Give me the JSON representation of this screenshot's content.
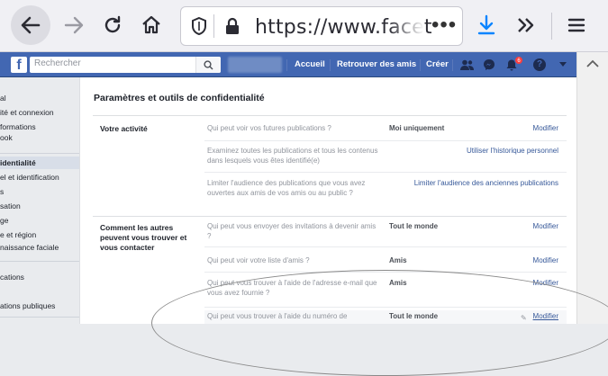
{
  "browser": {
    "url": "https://www.facet",
    "icons": {
      "back": "back-arrow-icon",
      "forward": "forward-arrow-icon",
      "reload": "reload-icon",
      "home": "home-icon",
      "shield": "tracking-protection-shield-icon",
      "lock": "lock-icon",
      "page_actions": "more-dots-icon",
      "download": "download-icon",
      "overflow": "chevron-double-right-icon",
      "menu": "hamburger-menu-icon"
    },
    "page_actions_label": "•••"
  },
  "fb_header": {
    "logo": "f",
    "search_placeholder": "Rechercher",
    "nav": [
      "Accueil",
      "Retrouver des amis",
      "Créer"
    ],
    "notification_count": "6",
    "help": "?",
    "colors": {
      "bar": "#4267b2",
      "border": "#29487d"
    }
  },
  "sidebar": {
    "items": [
      {
        "label": "al"
      },
      {
        "label": "ité et connexion"
      },
      {
        "label": "formations"
      },
      {
        "label": "ook"
      },
      {
        "label": "identialité",
        "active": true
      },
      {
        "label": "el et identification"
      },
      {
        "label": "s"
      },
      {
        "label": "sation"
      },
      {
        "label": "ge"
      },
      {
        "label": "e et région"
      },
      {
        "label": "naissance faciale"
      },
      {
        "label": "cations"
      },
      {
        "label": ""
      },
      {
        "label": "ations publiques"
      }
    ]
  },
  "main": {
    "title": "Paramètres et outils de confidentialité",
    "sections": [
      {
        "label": "Votre activité",
        "rows": [
          {
            "question": "Qui peut voir vos futures publications ?",
            "value": "Moi uniquement",
            "action": "Modifier"
          },
          {
            "question": "Examinez toutes les publications et tous les contenus dans lesquels vous êtes identifié(e)",
            "value": "",
            "action": "Utiliser l'historique personnel"
          },
          {
            "question": "Limiter l'audience des publications que vous avez ouvertes aux amis de vos amis ou au public ?",
            "value": "",
            "action": "Limiter l'audience des anciennes publications"
          }
        ]
      },
      {
        "label": "Comment les autres peuvent vous trouver et vous contacter",
        "rows": [
          {
            "question": "Qui peut vous envoyer des invitations à devenir amis ?",
            "value": "Tout le monde",
            "action": "Modifier"
          },
          {
            "question": "Qui peut voir votre liste d'amis ?",
            "value": "Amis",
            "action": "Modifier"
          },
          {
            "question": "Qui peut vous trouver à l'aide de l'adresse e-mail que vous avez fournie ?",
            "value": "Amis",
            "action": "Modifier"
          },
          {
            "question": "Qui peut vous trouver à l'aide du numéro de",
            "value": "Tout le monde",
            "action": "Modifier",
            "highlighted": true
          }
        ]
      }
    ]
  }
}
